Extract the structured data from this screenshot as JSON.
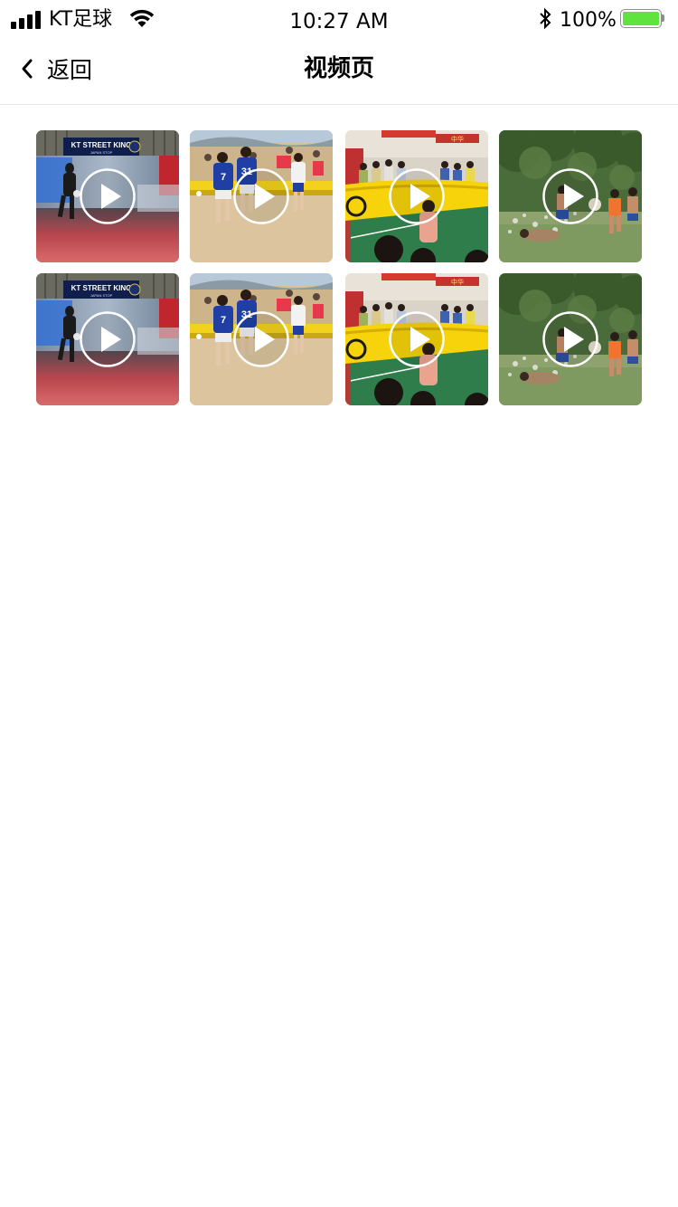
{
  "status_bar": {
    "carrier": "KT足球",
    "time": "10:27 AM",
    "battery_percent": "100%",
    "battery_level": 1.0,
    "icons": [
      "signal-icon",
      "wifi-icon",
      "bluetooth-icon",
      "battery-icon"
    ]
  },
  "nav": {
    "back_label": "返回",
    "title": "视频页",
    "back_icon": "chevron-left-icon"
  },
  "videos": [
    {
      "scene": "street-king",
      "banner_text": "KT STREET KING",
      "banner_sub": "JAPAN STOP"
    },
    {
      "scene": "beach",
      "jersey_numbers": [
        "7",
        "31"
      ]
    },
    {
      "scene": "arena",
      "board_text": "中华"
    },
    {
      "scene": "field"
    },
    {
      "scene": "street-king",
      "banner_text": "KT STREET KING",
      "banner_sub": "JAPAN STOP"
    },
    {
      "scene": "beach",
      "jersey_numbers": [
        "7",
        "31"
      ]
    },
    {
      "scene": "arena",
      "board_text": "中华"
    },
    {
      "scene": "field"
    }
  ],
  "colors": {
    "battery_fill": "#5ee33f",
    "divider": "#e6e6e6",
    "play_icon": "#ffffff"
  }
}
